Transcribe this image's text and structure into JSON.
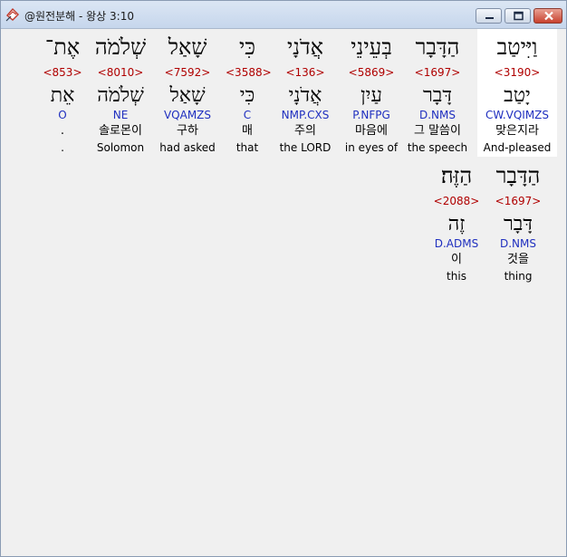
{
  "window": {
    "title": "@원전분해 - 왕상 3:10"
  },
  "colors": {
    "strong": "#b00000",
    "morph": "#1f2fbf",
    "highlight": "#ffffff"
  },
  "row1": [
    {
      "hebrew": "וַיִּיטַב",
      "strong": "<3190>",
      "lemma": "יָטַב",
      "morph": "CW.VQIMZS",
      "korean": "맞은지라",
      "english": "And-pleased"
    },
    {
      "hebrew": "הַדָּבָר",
      "strong": "<1697>",
      "lemma": "דָּבָר",
      "morph": "D.NMS",
      "korean": "그 말씀이",
      "english": "the speech"
    },
    {
      "hebrew": "בְּעֵינֵי",
      "strong": "<5869>",
      "lemma": "עַיִן",
      "morph": "P.NFPG",
      "korean": "마음에",
      "english": "in eyes of"
    },
    {
      "hebrew": "אֲדֹנָי",
      "strong": "<136>",
      "lemma": "אֲדֹנָי",
      "morph": "NMP.CXS",
      "korean": "주의",
      "english": "the LORD"
    },
    {
      "hebrew": "כִּי",
      "strong": "<3588>",
      "lemma": "כִּי",
      "morph": "C",
      "korean": "매",
      "english": "that"
    },
    {
      "hebrew": "שָׁאַל",
      "strong": "<7592>",
      "lemma": "שָׁאַל",
      "morph": "VQAMZS",
      "korean": "구하",
      "english": "had asked"
    },
    {
      "hebrew": "שְׁלֹמֹה",
      "strong": "<8010>",
      "lemma": "שְׁלֹמֹה",
      "morph": "NE",
      "korean": "솔로몬이",
      "english": "Solomon"
    },
    {
      "hebrew": "אֶת־",
      "strong": "<853>",
      "lemma": "אֵת",
      "morph": "O",
      "korean": ".",
      "english": "."
    }
  ],
  "row2": [
    {
      "hebrew": "הַדָּבָר",
      "strong": "<1697>",
      "lemma": "דָּבָר",
      "morph": "D.NMS",
      "korean": "것을",
      "english": "thing"
    },
    {
      "hebrew": "הַזֶּה׃",
      "strong": "<2088>",
      "lemma": "זֶה",
      "morph": "D.ADMS",
      "korean": "이",
      "english": "this"
    }
  ]
}
